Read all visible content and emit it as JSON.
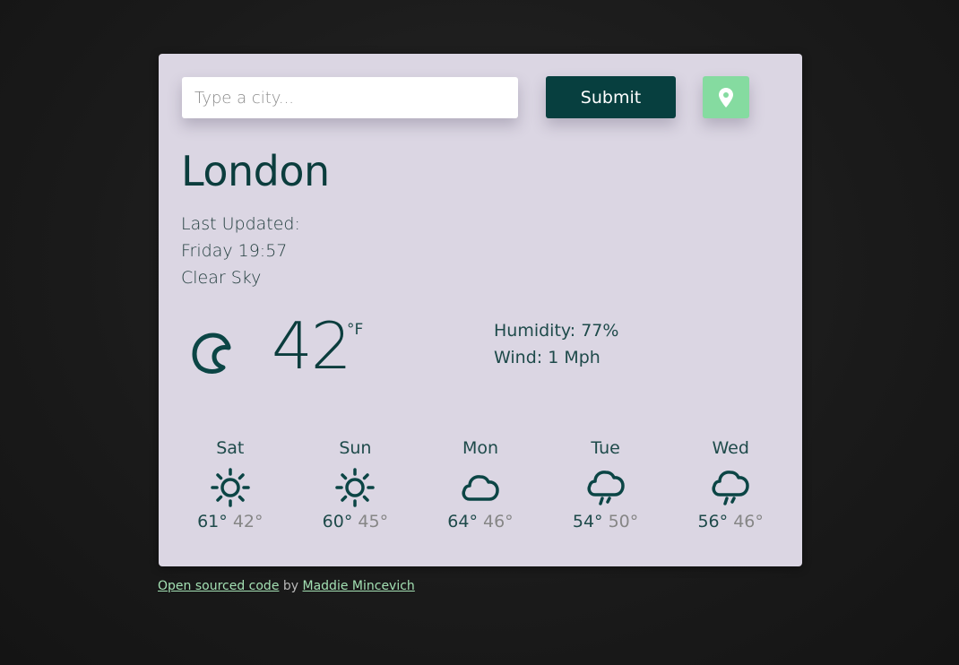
{
  "search": {
    "placeholder": "Type a city..."
  },
  "submit_label": "Submit",
  "location_icon": "map-pin-icon",
  "current": {
    "city": "London",
    "last_updated_label": "Last Updated:",
    "last_updated": "Friday 19:57",
    "description": "Clear Sky",
    "icon": "moon-icon",
    "temperature": "42",
    "unit": "°F",
    "humidity": "Humidity: 77%",
    "wind": "Wind: 1 Mph"
  },
  "forecast": [
    {
      "day": "Sat",
      "icon": "sun-icon",
      "high": "61°",
      "low": "42°"
    },
    {
      "day": "Sun",
      "icon": "sun-icon",
      "high": "60°",
      "low": "45°"
    },
    {
      "day": "Mon",
      "icon": "cloud-icon",
      "high": "64°",
      "low": "46°"
    },
    {
      "day": "Tue",
      "icon": "rain-cloud-icon",
      "high": "54°",
      "low": "50°"
    },
    {
      "day": "Wed",
      "icon": "rain-cloud-icon",
      "high": "56°",
      "low": "46°"
    }
  ],
  "footer": {
    "link1": "Open sourced code",
    "by": " by ",
    "link2": "Maddie Mincevich"
  },
  "colors": {
    "card_bg": "#dbd6e3",
    "primary": "#073f3f",
    "accent": "#85dba0",
    "page_bg": "#1c1c1c"
  }
}
